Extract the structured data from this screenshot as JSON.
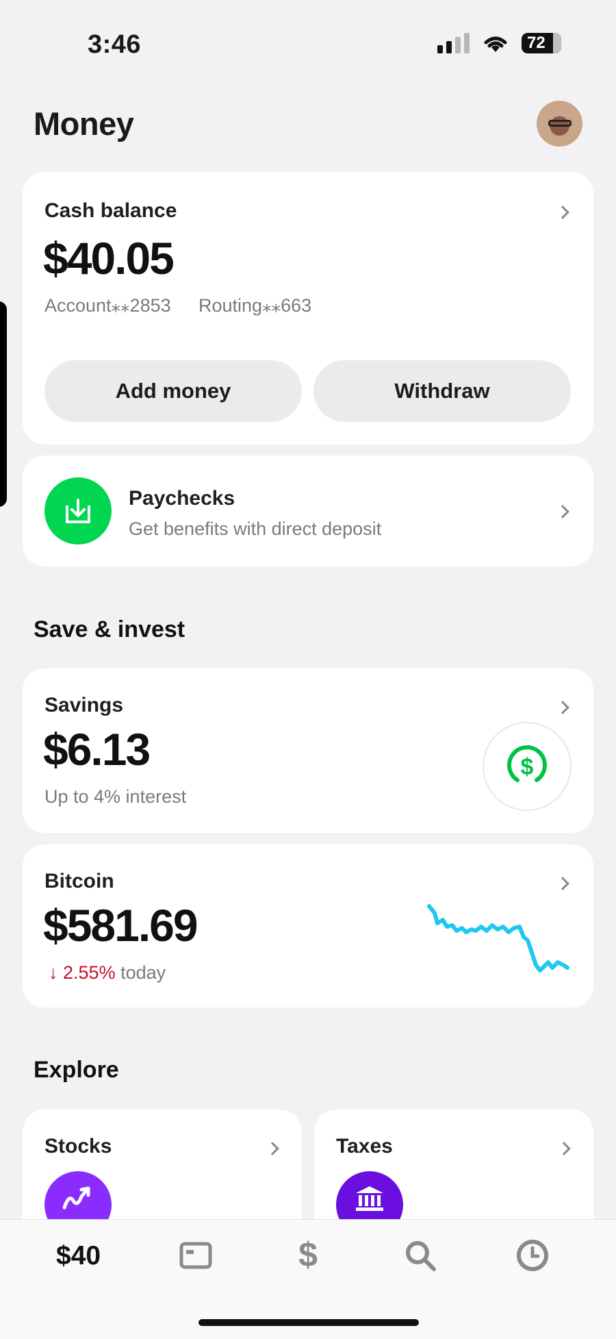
{
  "status_bar": {
    "time": "3:46",
    "battery": "72"
  },
  "header": {
    "title": "Money"
  },
  "cash": {
    "label": "Cash balance",
    "amount": "$40.05",
    "account": "Account⁎⁎2853",
    "routing": "Routing⁎⁎663",
    "add_money": "Add money",
    "withdraw": "Withdraw"
  },
  "paychecks": {
    "title": "Paychecks",
    "subtitle": "Get benefits with direct deposit"
  },
  "save_invest": {
    "section_title": "Save & invest"
  },
  "savings": {
    "label": "Savings",
    "amount": "$6.13",
    "subtitle": "Up to 4% interest"
  },
  "bitcoin": {
    "label": "Bitcoin",
    "amount": "$581.69",
    "change_arrow": "↓",
    "change": "2.55%",
    "change_suffix": "today"
  },
  "explore": {
    "section_title": "Explore",
    "stocks": "Stocks",
    "taxes": "Taxes"
  },
  "tabbar": {
    "balance": "$40"
  },
  "colors": {
    "green": "#00d64f",
    "purple": "#8b2cff",
    "violet": "#6a0fe0",
    "spark": "#1ec8ef",
    "down": "#c8102e"
  }
}
